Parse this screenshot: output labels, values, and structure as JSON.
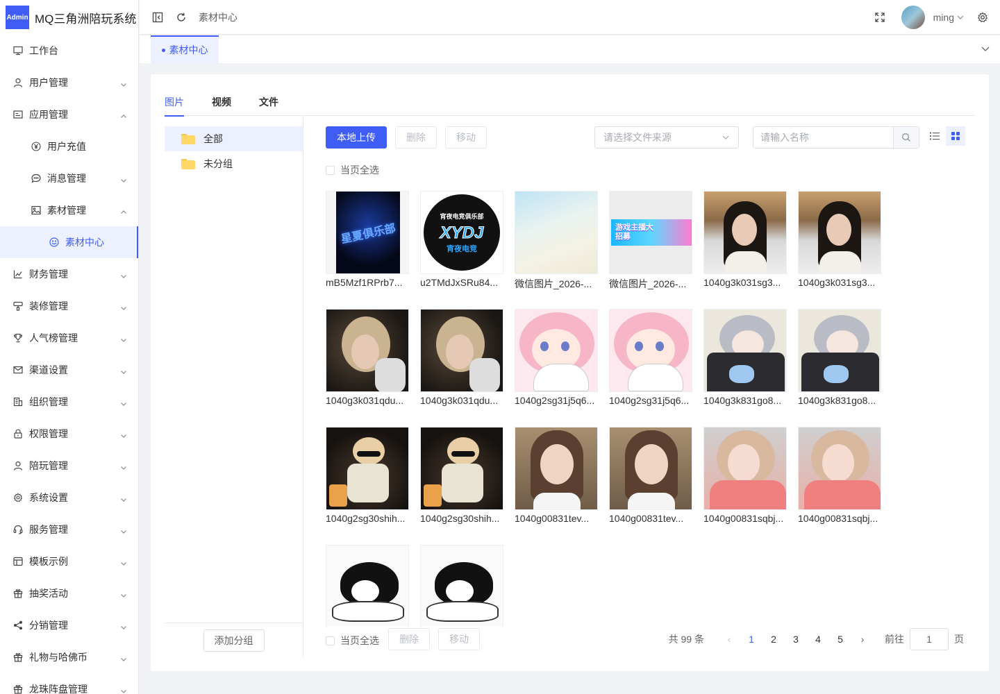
{
  "app": {
    "logo_text": "Admin",
    "title": "MQ三角洲陪玩系统"
  },
  "sidebar": {
    "items": [
      {
        "label": "工作台",
        "icon": "monitor-icon",
        "expandable": false
      },
      {
        "label": "用户管理",
        "icon": "user-icon",
        "expandable": true,
        "expanded": false
      },
      {
        "label": "应用管理",
        "icon": "app-icon",
        "expandable": true,
        "expanded": true
      },
      {
        "label": "用户充值",
        "icon": "yen-icon",
        "level": 2
      },
      {
        "label": "消息管理",
        "icon": "message-icon",
        "level": 2,
        "expandable": true,
        "expanded": false
      },
      {
        "label": "素材管理",
        "icon": "image-icon",
        "level": 2,
        "expandable": true,
        "expanded": true
      },
      {
        "label": "素材中心",
        "icon": "smile-icon",
        "level": 3,
        "active": true
      },
      {
        "label": "财务管理",
        "icon": "chart-icon",
        "expandable": true
      },
      {
        "label": "装修管理",
        "icon": "brush-icon",
        "expandable": true
      },
      {
        "label": "人气榜管理",
        "icon": "trophy-icon",
        "expandable": true
      },
      {
        "label": "渠道设置",
        "icon": "mail-icon",
        "expandable": true
      },
      {
        "label": "组织管理",
        "icon": "building-icon",
        "expandable": true
      },
      {
        "label": "权限管理",
        "icon": "lock-icon",
        "expandable": true
      },
      {
        "label": "陪玩管理",
        "icon": "user-icon",
        "expandable": true
      },
      {
        "label": "系统设置",
        "icon": "gear-icon",
        "expandable": true
      },
      {
        "label": "服务管理",
        "icon": "headset-icon",
        "expandable": true
      },
      {
        "label": "模板示例",
        "icon": "template-icon",
        "expandable": true
      },
      {
        "label": "抽奖活动",
        "icon": "gift-icon",
        "expandable": true
      },
      {
        "label": "分销管理",
        "icon": "share-icon",
        "expandable": true
      },
      {
        "label": "礼物与哈佛币",
        "icon": "gift-icon",
        "expandable": true
      },
      {
        "label": "龙珠阵盘管理",
        "icon": "gift-icon",
        "expandable": true
      }
    ]
  },
  "header": {
    "breadcrumb": "素材中心",
    "username": "ming"
  },
  "tags": {
    "active": "素材中心"
  },
  "tabs": [
    {
      "label": "图片",
      "active": true
    },
    {
      "label": "视频"
    },
    {
      "label": "文件"
    }
  ],
  "groups": {
    "items": [
      {
        "label": "全部",
        "active": true
      },
      {
        "label": "未分组"
      }
    ],
    "add_button": "添加分组"
  },
  "toolbar": {
    "upload": "本地上传",
    "delete": "删除",
    "move": "移动",
    "source_placeholder": "请选择文件来源",
    "search_placeholder": "请输入名称"
  },
  "select_all": "当页全选",
  "files": [
    {
      "name": "mB5Mzf1RPrb7...",
      "thumb": "dark-logo"
    },
    {
      "name": "u2TMdJxSRu84...",
      "thumb": "circle-logo"
    },
    {
      "name": "微信图片_2026-...",
      "thumb": "gradient-light"
    },
    {
      "name": "微信图片_2026-...",
      "thumb": "banner"
    },
    {
      "name": "1040g3k031sg3...",
      "thumb": "portrait-a"
    },
    {
      "name": "1040g3k031sg3...",
      "thumb": "portrait-a"
    },
    {
      "name": "1040g3k031qdu...",
      "thumb": "portrait-b"
    },
    {
      "name": "1040g3k031qdu...",
      "thumb": "portrait-b"
    },
    {
      "name": "1040g2sg31j5q6...",
      "thumb": "anime-pink"
    },
    {
      "name": "1040g2sg31j5q6...",
      "thumb": "anime-pink"
    },
    {
      "name": "1040g3k831go8...",
      "thumb": "anime-grey"
    },
    {
      "name": "1040g3k831go8...",
      "thumb": "anime-grey"
    },
    {
      "name": "1040g2sg30shih...",
      "thumb": "anime-dark"
    },
    {
      "name": "1040g2sg30shih...",
      "thumb": "anime-dark"
    },
    {
      "name": "1040g00831tev...",
      "thumb": "portrait-c"
    },
    {
      "name": "1040g00831tev...",
      "thumb": "portrait-c"
    },
    {
      "name": "1040g00831sqbj...",
      "thumb": "portrait-d"
    },
    {
      "name": "1040g00831sqbj...",
      "thumb": "portrait-d"
    },
    {
      "name": "",
      "thumb": "chibi"
    },
    {
      "name": "",
      "thumb": "chibi"
    }
  ],
  "dark_logo_text": "星夏俱乐部",
  "circle_logo_text": "XYDJ",
  "circle_logo_arc": "宵夜电竞俱乐部",
  "circle_logo_sub": "宵夜电竞",
  "banner_text": "游戏主播大招募",
  "pagination": {
    "total_text": "共 99 条",
    "pages": [
      "1",
      "2",
      "3",
      "4",
      "5"
    ],
    "current": "1",
    "goto_label": "前往",
    "goto_value": "1",
    "page_suffix": "页"
  },
  "colors": {
    "primary": "#3f5df5",
    "active_bg": "#ecf0ff"
  }
}
